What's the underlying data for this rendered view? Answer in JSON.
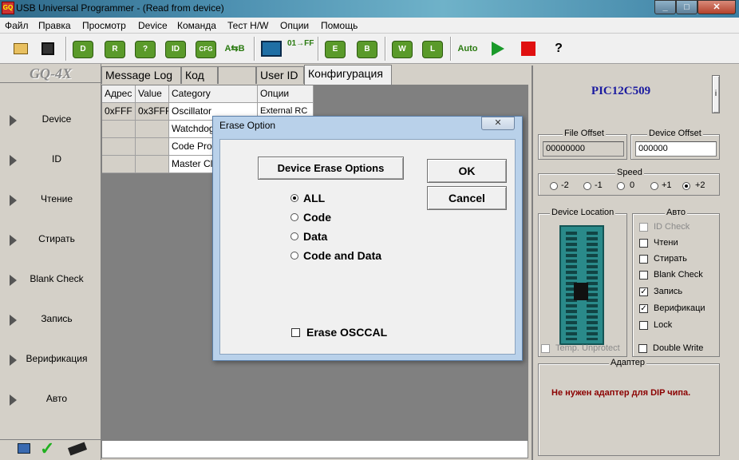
{
  "window": {
    "title": "USB Universal Programmer - (Read from device)",
    "icon_text": "GQ"
  },
  "menu": [
    "Файл",
    "Правка",
    "Просмотр",
    "Device",
    "Команда",
    "Тест H/W",
    "Опции",
    "Помощь"
  ],
  "toolbar": {
    "buttons": [
      {
        "name": "open-icon",
        "text": ""
      },
      {
        "name": "save-icon",
        "text": ""
      },
      {
        "name": "device-icon",
        "text": "D"
      },
      {
        "name": "read-icon",
        "text": "R"
      },
      {
        "name": "verify-icon",
        "text": "?"
      },
      {
        "name": "id-icon",
        "text": "ID"
      },
      {
        "name": "config-icon",
        "text": "CFG"
      },
      {
        "name": "compare-icon",
        "text": "A⇆B"
      },
      {
        "name": "calculator-icon",
        "text": ""
      },
      {
        "name": "fill-icon",
        "text": "01→FF"
      },
      {
        "name": "erase-icon",
        "text": "E"
      },
      {
        "name": "blank-check-icon",
        "text": "B"
      },
      {
        "name": "write-icon",
        "text": "W"
      },
      {
        "name": "lock-icon",
        "text": "L"
      },
      {
        "name": "auto-icon",
        "text": "Auto"
      },
      {
        "name": "run-icon",
        "text": ""
      },
      {
        "name": "stop-icon",
        "text": ""
      },
      {
        "name": "help-icon",
        "text": "?"
      }
    ]
  },
  "left_panel": {
    "logo": "GQ-4X",
    "items": [
      "Device",
      "ID",
      "Чтение",
      "Стирать",
      "Blank Check",
      "Запись",
      "Верификация",
      "Авто"
    ]
  },
  "tabs": [
    "Message Log",
    "Код",
    "",
    "User ID",
    "Конфигурация"
  ],
  "grid": {
    "headers": [
      "Адрес",
      "Value",
      "Category",
      "Опции"
    ],
    "rows": [
      [
        "0xFFF",
        "0x3FFF",
        "Oscillator",
        "External RC"
      ],
      [
        "",
        "",
        "Watchdog",
        ""
      ],
      [
        "",
        "",
        "Code Prot",
        ""
      ],
      [
        "",
        "",
        "Master Cl",
        ""
      ]
    ]
  },
  "right_panel": {
    "chip_name": "PIC12C509",
    "info_button": "i",
    "file_offset": {
      "label": "File Offset",
      "value": "00000000"
    },
    "device_offset": {
      "label": "Device Offset",
      "value": "000000"
    },
    "speed": {
      "label": "Speed",
      "options": [
        "-2",
        "-1",
        "0",
        "+1",
        "+2"
      ],
      "selected": "+2"
    },
    "device_location": "Device Location",
    "temp_unprotect": "Temp. Unprotect",
    "auto": {
      "label": "Авто",
      "items": [
        {
          "label": "ID Check",
          "checked": false,
          "disabled": true
        },
        {
          "label": "Чтени",
          "checked": false,
          "disabled": false
        },
        {
          "label": "Стирать",
          "checked": false,
          "disabled": false
        },
        {
          "label": "Blank Check",
          "checked": false,
          "disabled": false
        },
        {
          "label": "Запись",
          "checked": true,
          "disabled": false
        },
        {
          "label": "Верификаци",
          "checked": true,
          "disabled": false
        },
        {
          "label": "Lock",
          "checked": false,
          "disabled": false
        }
      ],
      "double_write": "Double Write"
    },
    "adapter": {
      "label": "Адаптер",
      "message": "Не нужен адаптер для  DIP чипа."
    }
  },
  "dialog": {
    "title": "Erase Option",
    "close_glyph": "✕",
    "group_label": "Device Erase Options",
    "ok": "OK",
    "cancel": "Cancel",
    "options": [
      "ALL",
      "Code",
      "Data",
      "Code and Data"
    ],
    "selected": "ALL",
    "erase_osccal": "Erase OSCCAL"
  },
  "colors": {
    "chip_name": "#1a1aa0",
    "adapter_message": "#8b0000",
    "socket": "#2a8a8a"
  }
}
